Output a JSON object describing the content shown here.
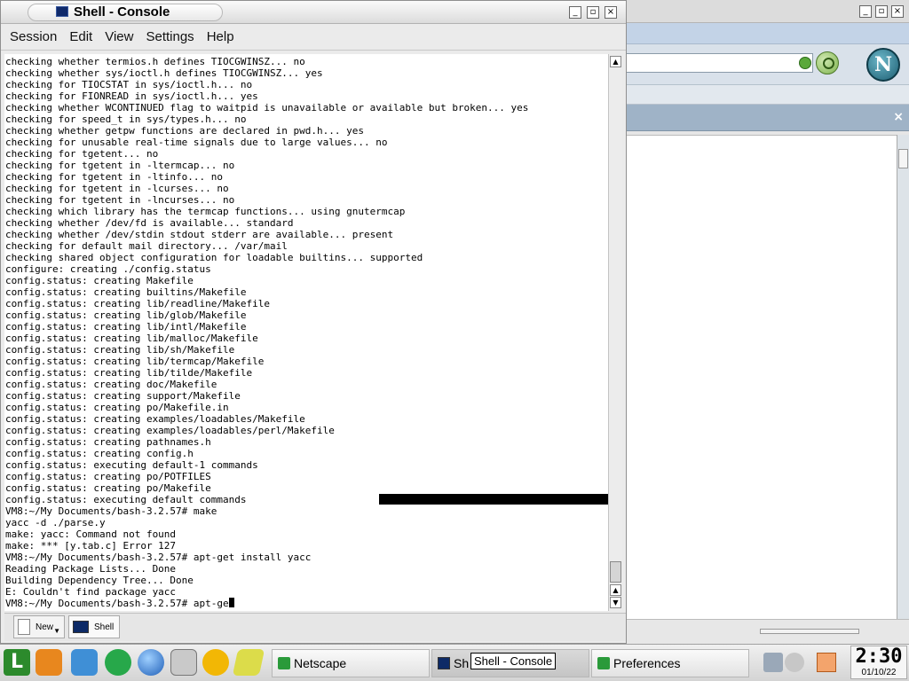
{
  "console": {
    "title": "Shell - Console",
    "menu": [
      "Session",
      "Edit",
      "View",
      "Settings",
      "Help"
    ],
    "lines": [
      "checking whether termios.h defines TIOCGWINSZ... no",
      "checking whether sys/ioctl.h defines TIOCGWINSZ... yes",
      "checking for TIOCSTAT in sys/ioctl.h... no",
      "checking for FIONREAD in sys/ioctl.h... yes",
      "checking whether WCONTINUED flag to waitpid is unavailable or available but broken... yes",
      "checking for speed_t in sys/types.h... no",
      "checking whether getpw functions are declared in pwd.h... yes",
      "checking for unusable real-time signals due to large values... no",
      "checking for tgetent... no",
      "checking for tgetent in -ltermcap... no",
      "checking for tgetent in -ltinfo... no",
      "checking for tgetent in -lcurses... no",
      "checking for tgetent in -lncurses... no",
      "checking which library has the termcap functions... using gnutermcap",
      "checking whether /dev/fd is available... standard",
      "checking whether /dev/stdin stdout stderr are available... present",
      "checking for default mail directory... /var/mail",
      "checking shared object configuration for loadable builtins... supported",
      "configure: creating ./config.status",
      "config.status: creating Makefile",
      "config.status: creating builtins/Makefile",
      "config.status: creating lib/readline/Makefile",
      "config.status: creating lib/glob/Makefile",
      "config.status: creating lib/intl/Makefile",
      "config.status: creating lib/malloc/Makefile",
      "config.status: creating lib/sh/Makefile",
      "config.status: creating lib/termcap/Makefile",
      "config.status: creating lib/tilde/Makefile",
      "config.status: creating doc/Makefile",
      "config.status: creating support/Makefile",
      "config.status: creating po/Makefile.in",
      "config.status: creating examples/loadables/Makefile",
      "config.status: creating examples/loadables/perl/Makefile",
      "config.status: creating pathnames.h",
      "config.status: creating config.h",
      "config.status: executing default-1 commands",
      "config.status: creating po/POTFILES",
      "config.status: creating po/Makefile",
      "config.status: executing default commands",
      "VM8:~/My Documents/bash-3.2.57# make",
      "yacc -d ./parse.y",
      "make: yacc: Command not found",
      "make: *** [y.tab.c] Error 127",
      "VM8:~/My Documents/bash-3.2.57# apt-get install yacc",
      "Reading Package Lists... Done",
      "Building Dependency Tree... Done",
      "E: Couldn't find package yacc"
    ],
    "prompt_line": "VM8:~/My Documents/bash-3.2.57# apt-ge",
    "tabs": {
      "new": "New",
      "shell": "Shell"
    }
  },
  "taskbar": {
    "tasks": {
      "netscape": "Netscape",
      "shell": "Sh",
      "preferences": "Preferences"
    },
    "tooltip": "Shell - Console",
    "clock_time": "2:30",
    "clock_date": "01/10/22"
  },
  "colors": {
    "terminal_bg": "#ffffff",
    "terminal_fg": "#000000",
    "shell_icon": "#0d2a66",
    "netscape_accent": "#2a9a3a"
  }
}
